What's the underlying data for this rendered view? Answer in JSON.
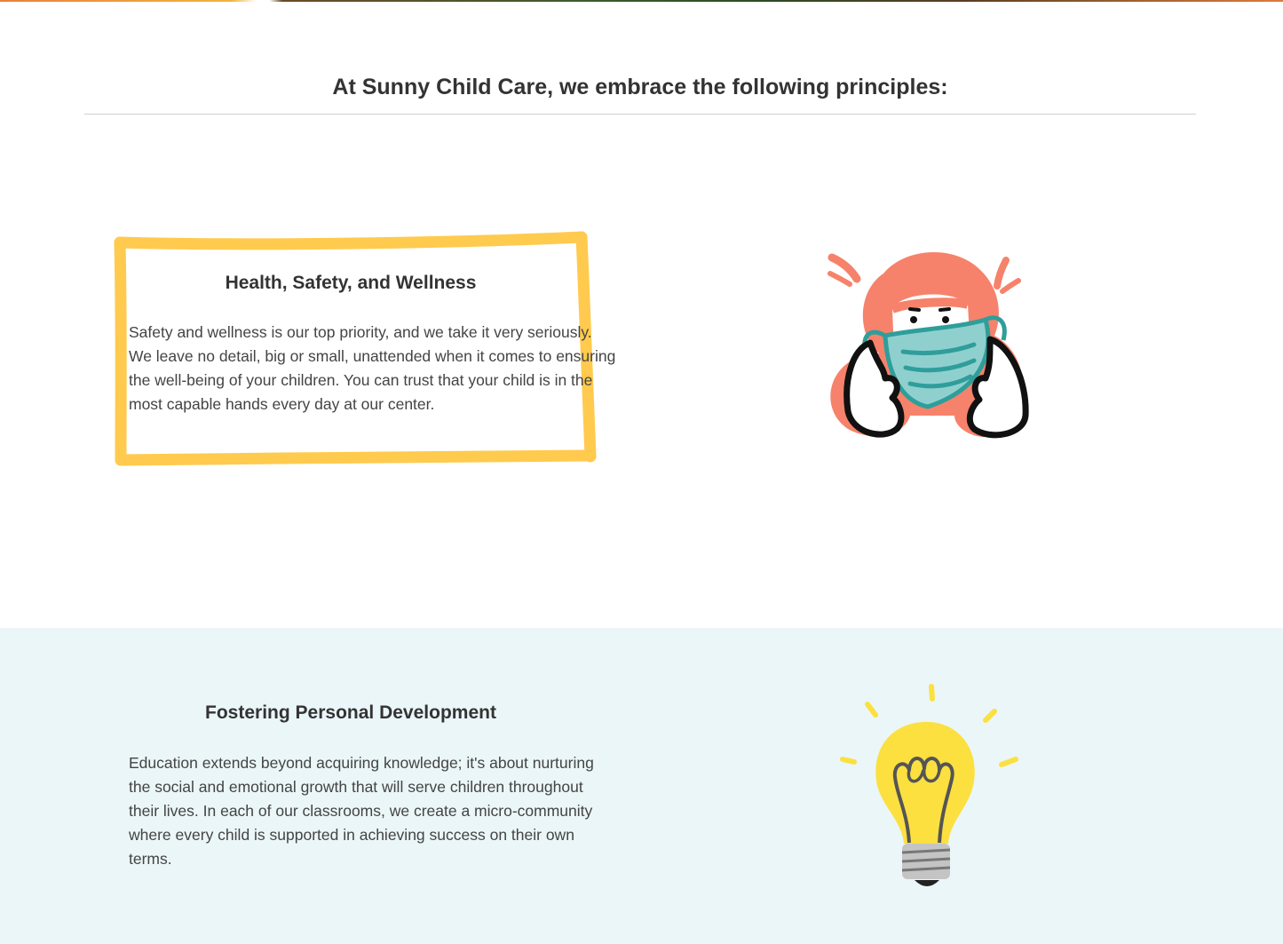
{
  "intro": {
    "heading": "At Sunny Child Care, we embrace the following principles:"
  },
  "principles": [
    {
      "title": "Health, Safety, and Wellness",
      "body": "Safety and wellness is our top priority, and we take it very seriously. We leave no detail, big or small, unattended when it comes to ensuring the well-being of your children. You can trust that your child is in the most capable hands every day at our center.",
      "illustration": "masked-girl-icon"
    },
    {
      "title": "Fostering Personal Development",
      "body": "Education extends beyond acquiring knowledge; it's about nurturing the social and emotional growth that will serve children throughout their lives. In each of our classrooms, we create a micro-community where every child is supported in achieving success on their own terms.",
      "illustration": "lightbulb-icon"
    }
  ],
  "colors": {
    "highlight": "#ffc845",
    "section_alt_bg": "#ebf6f8",
    "hair": "#f6826b",
    "mask": "#8fd0cf",
    "mask_stroke": "#2f9e9a",
    "bulb": "#fbe040",
    "bulb_base": "#c4c4c4"
  }
}
